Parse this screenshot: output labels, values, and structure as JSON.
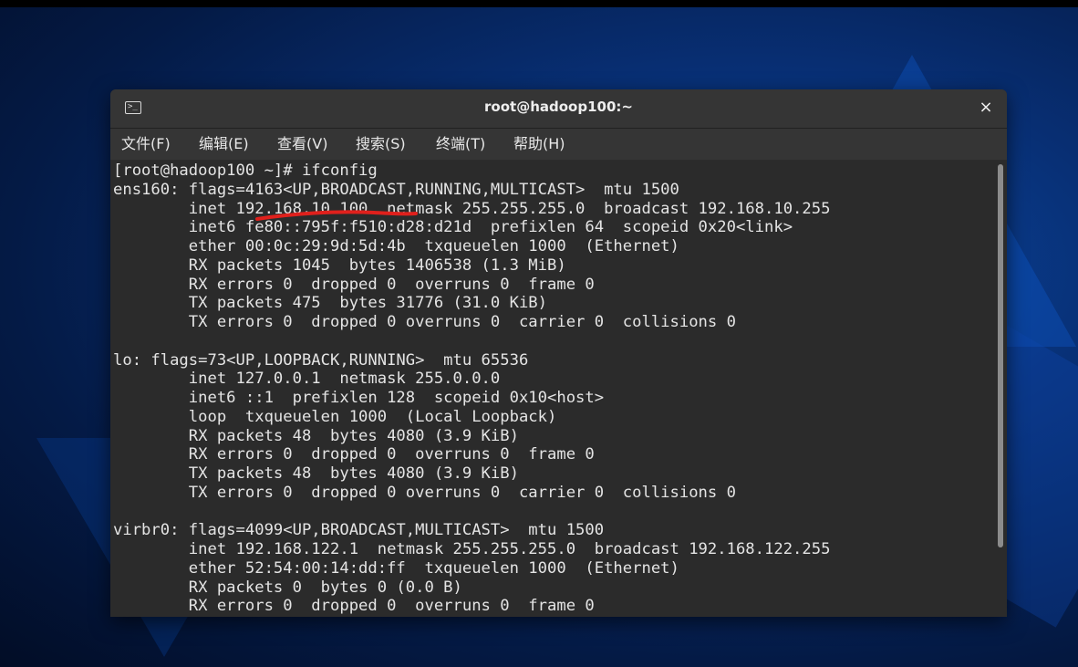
{
  "window": {
    "title": "root@hadoop100:~",
    "close_label": "×",
    "terminal_icon_glyph": "⊵"
  },
  "menu": {
    "items": [
      {
        "label": "文件(F)"
      },
      {
        "label": "编辑(E)"
      },
      {
        "label": "查看(V)"
      },
      {
        "label": "搜索(S)"
      },
      {
        "label": "终端(T)"
      },
      {
        "label": "帮助(H)"
      }
    ]
  },
  "terminal": {
    "lines": [
      "[root@hadoop100 ~]# ifconfig",
      "ens160: flags=4163<UP,BROADCAST,RUNNING,MULTICAST>  mtu 1500",
      "        inet 192.168.10.100  netmask 255.255.255.0  broadcast 192.168.10.255",
      "        inet6 fe80::795f:f510:d28:d21d  prefixlen 64  scopeid 0x20<link>",
      "        ether 00:0c:29:9d:5d:4b  txqueuelen 1000  (Ethernet)",
      "        RX packets 1045  bytes 1406538 (1.3 MiB)",
      "        RX errors 0  dropped 0  overruns 0  frame 0",
      "        TX packets 475  bytes 31776 (31.0 KiB)",
      "        TX errors 0  dropped 0 overruns 0  carrier 0  collisions 0",
      "",
      "lo: flags=73<UP,LOOPBACK,RUNNING>  mtu 65536",
      "        inet 127.0.0.1  netmask 255.0.0.0",
      "        inet6 ::1  prefixlen 128  scopeid 0x10<host>",
      "        loop  txqueuelen 1000  (Local Loopback)",
      "        RX packets 48  bytes 4080 (3.9 KiB)",
      "        RX errors 0  dropped 0  overruns 0  frame 0",
      "        TX packets 48  bytes 4080 (3.9 KiB)",
      "        TX errors 0  dropped 0 overruns 0  carrier 0  collisions 0",
      "",
      "virbr0: flags=4099<UP,BROADCAST,MULTICAST>  mtu 1500",
      "        inet 192.168.122.1  netmask 255.255.255.0  broadcast 192.168.122.255",
      "        ether 52:54:00:14:dd:ff  txqueuelen 1000  (Ethernet)",
      "        RX packets 0  bytes 0 (0.0 B)",
      "        RX errors 0  dropped 0  overruns 0  frame 0"
    ]
  },
  "colors": {
    "annotation_underline": "#e0201c",
    "terminal_text": "#e4e4e4",
    "terminal_background": "#2b2b2b"
  }
}
